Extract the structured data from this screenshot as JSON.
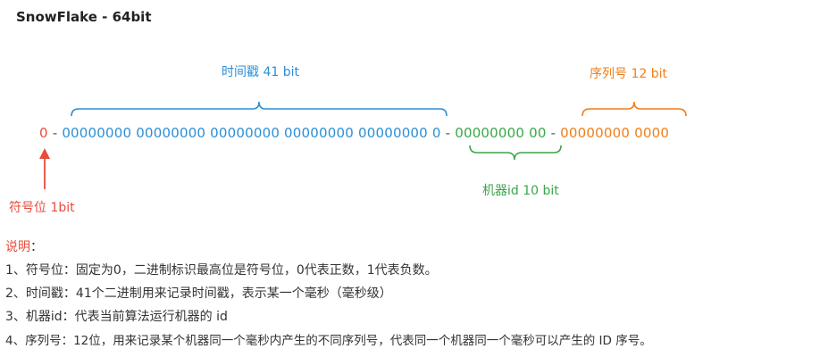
{
  "title": "SnowFlake - 64bit",
  "colors": {
    "sign": "#e74c3c",
    "timestamp": "#2d8fd5",
    "machine": "#3aa64b",
    "sequence": "#ef7f1a",
    "separator": "#555555"
  },
  "bits": {
    "sign": "0",
    "sep1": " - ",
    "timestamp": "00000000 00000000 00000000 00000000 00000000 0",
    "sep2": " - ",
    "machine": "00000000 00",
    "sep3": " - ",
    "sequence": "00000000 0000"
  },
  "labels": {
    "timestamp": "时间戳 41 bit",
    "sequence": "序列号 12 bit",
    "machine": "机器id 10 bit",
    "sign": "符号位 1bit"
  },
  "notes": {
    "heading": "说明",
    "heading_colon": "：",
    "lines": [
      "1、符号位：固定为0，二进制标识最高位是符号位，0代表正数，1代表负数。",
      "2、时间戳：41个二进制用来记录时间戳，表示某一个毫秒（毫秒级）",
      "3、机器id：代表当前算法运行机器的 id",
      "4、序列号：12位，用来记录某个机器同一个毫秒内产生的不同序列号，代表同一个机器同一个毫秒可以产生的 ID 序号。"
    ]
  }
}
